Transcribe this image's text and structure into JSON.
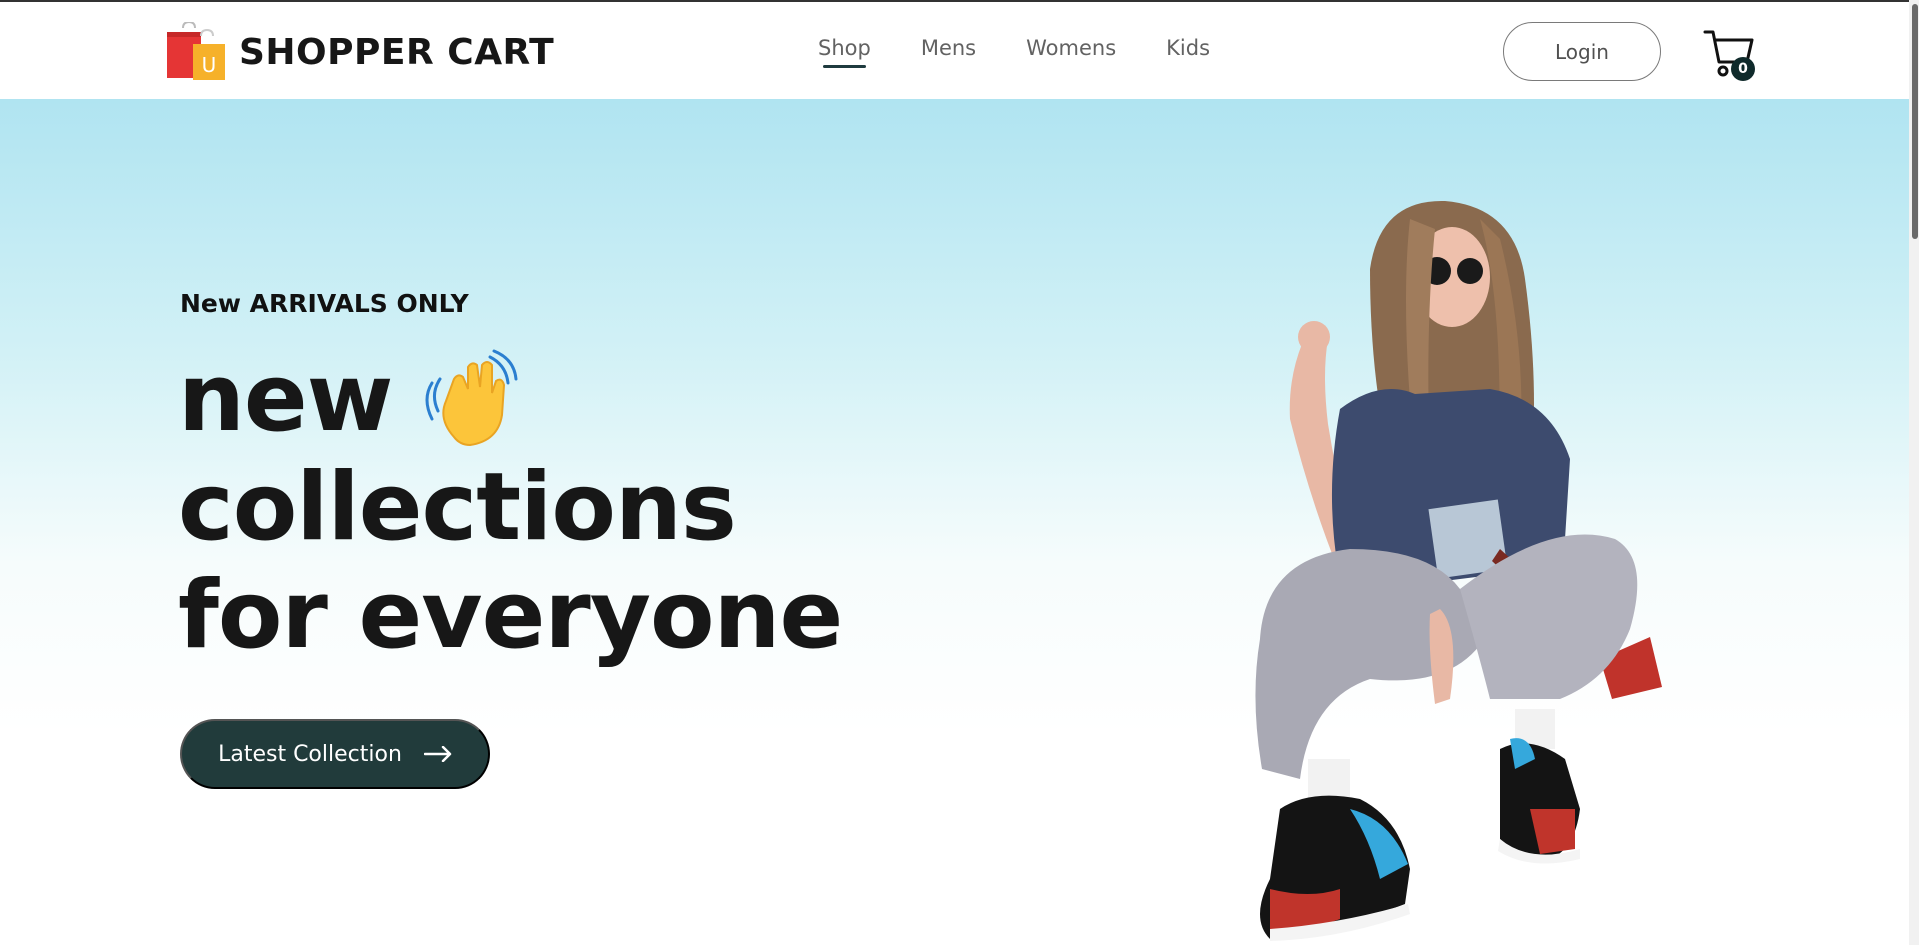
{
  "brand": {
    "name": "SHOPPER CART",
    "logo_letter": "U"
  },
  "nav": {
    "items": [
      {
        "label": "Shop",
        "active": true
      },
      {
        "label": "Mens",
        "active": false
      },
      {
        "label": "Womens",
        "active": false
      },
      {
        "label": "Kids",
        "active": false
      }
    ]
  },
  "header": {
    "login_label": "Login",
    "cart_count": "0"
  },
  "hero": {
    "tagline": "New ARRIVALS ONLY",
    "line1": "new",
    "line2": "collections",
    "line3": "for everyone",
    "cta_label": "Latest Collection"
  },
  "colors": {
    "accent": "#213b3b",
    "hero_top": "#b0e4f1",
    "cart_badge": "#0f2a2b"
  },
  "icons": [
    "shopping-bag-logo-icon",
    "cart-icon",
    "waving-hand-icon",
    "arrow-right-icon"
  ]
}
